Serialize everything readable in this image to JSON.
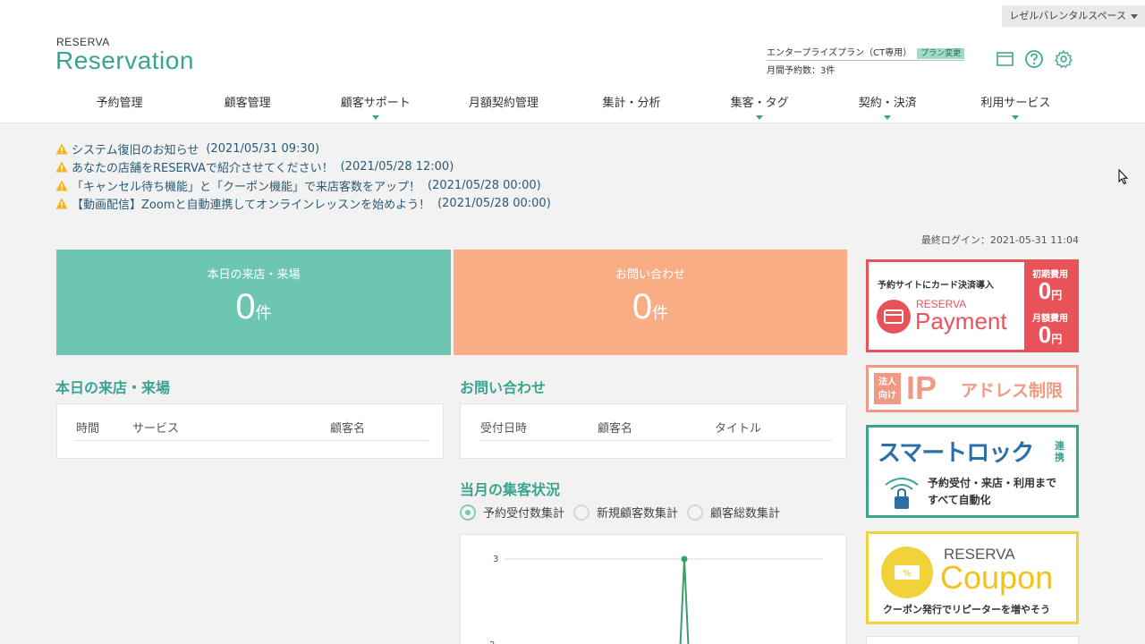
{
  "header": {
    "account_switch": "レゼルバレンタルスペース",
    "logo_small": "RESERVA",
    "logo_big": "Reservation",
    "plan_name": "エンタープライズプラン（CT専用）",
    "plan_change": "プラン変更",
    "monthly_reservations": "月間予約数：3件",
    "icons": [
      "calendar-icon",
      "help-icon",
      "gear-icon"
    ]
  },
  "nav": [
    {
      "label": "予約管理"
    },
    {
      "label": "顧客管理"
    },
    {
      "label": "顧客サポート"
    },
    {
      "label": "月額契約管理"
    },
    {
      "label": "集計・分析"
    },
    {
      "label": "集客・タグ"
    },
    {
      "label": "契約・決済"
    },
    {
      "label": "利用サービス"
    }
  ],
  "notices": [
    {
      "title": "システム復旧のお知らせ",
      "date": "(2021/05/31 09:30)"
    },
    {
      "title": "あなたの店舗をRESERVAで紹介させてください！",
      "date": "(2021/05/28 12:00)"
    },
    {
      "title": "「キャンセル待ち機能」と「クーポン機能」で来店客数をアップ！",
      "date": "(2021/05/28 00:00)"
    },
    {
      "title": "【動画配信】Zoomと自動連携してオンラインレッスンを始めよう！",
      "date": "(2021/05/28 00:00)"
    }
  ],
  "last_login": "最終ログイン：2021-05-31 11:04",
  "stats": {
    "visits": {
      "label": "本日の来店・来場",
      "value": "0",
      "unit": "件"
    },
    "inquiries": {
      "label": "お問い合わせ",
      "value": "0",
      "unit": "件"
    }
  },
  "today_visits": {
    "title": "本日の来店・来場",
    "columns": [
      "時間",
      "サービス",
      "顧客名"
    ]
  },
  "inquiries": {
    "title": "お問い合わせ",
    "columns": [
      "受付日時",
      "顧客名",
      "タイトル"
    ]
  },
  "monthly": {
    "title": "当月の集客状況",
    "options": [
      "予約受付数集計",
      "新規顧客数集計",
      "顧客総数集計"
    ],
    "selected": "予約受付数集計"
  },
  "chart_data": {
    "type": "line",
    "title": "",
    "y_ticks": [
      "3",
      "2"
    ],
    "ylim": [
      2,
      3
    ],
    "note": "partially visible; line spikes to value 3 at a single day",
    "series": [
      {
        "values": [
          0,
          3,
          0
        ],
        "color": "#3a9e6e"
      }
    ]
  },
  "banners": {
    "payment": {
      "top": "予約サイトにカード決済導入",
      "reserva": "RESERVA",
      "word": "Payment",
      "cap1": "初期費用",
      "val1": "0",
      "cap2": "月額費用",
      "val2": "0",
      "yen": "円"
    },
    "ip": {
      "tag1": "法人",
      "tag2": "向け",
      "big": "IP",
      "rest": "アドレス制限"
    },
    "lock": {
      "title": "スマートロック",
      "sub": "連携",
      "desc1": "予約受付・来店・利用まで",
      "desc2": "すべて自動化"
    },
    "coupon": {
      "reserva": "RESERVA",
      "word": "Coupon",
      "desc": "クーポン発行でリピーターを増やそう"
    }
  },
  "colors": {
    "accent": "#3aa48f",
    "visits": "#6cc6b1",
    "inquiries": "#f9ad84",
    "payment": "#e8535a",
    "ip": "#f09a86",
    "lock": "#2a6fa8",
    "coupon": "#f0d23a"
  }
}
